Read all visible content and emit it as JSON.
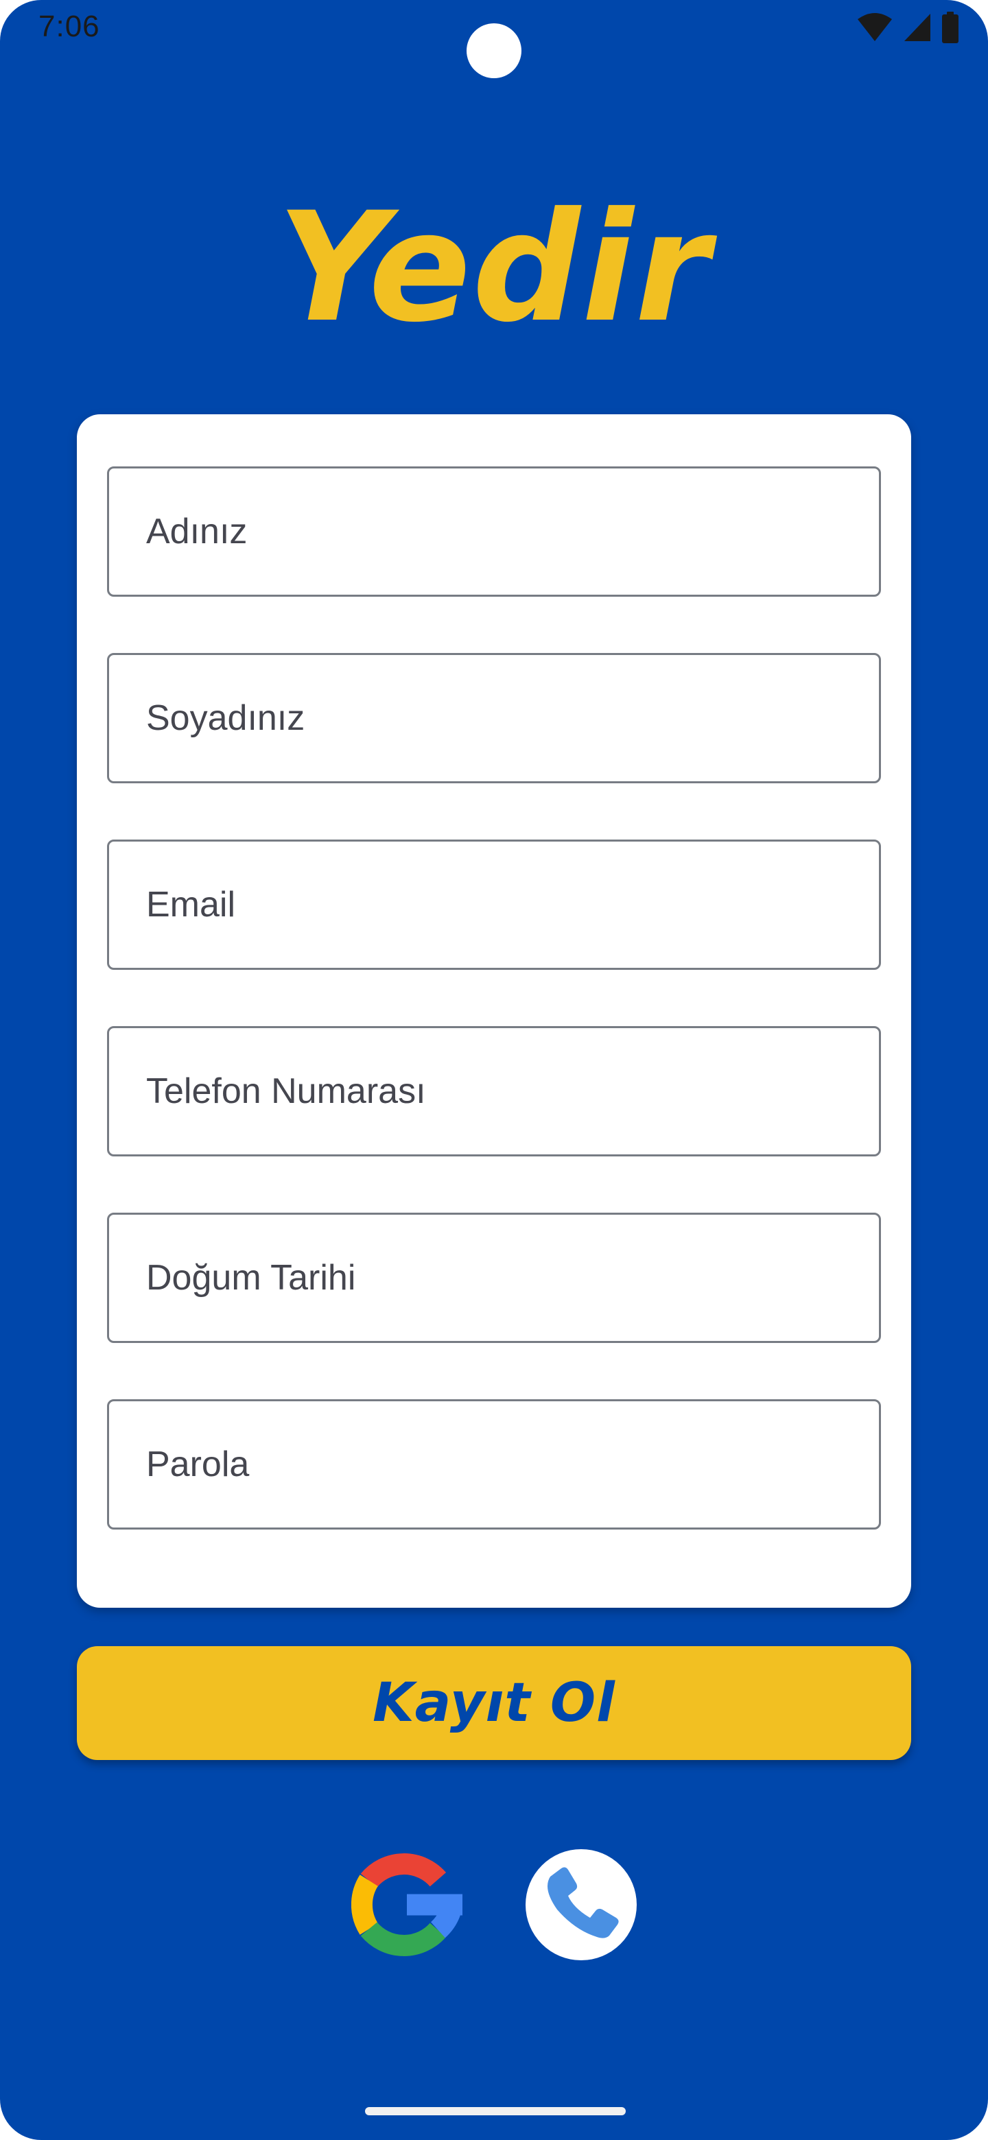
{
  "status_bar": {
    "time": "7:06",
    "icons": [
      "wifi-icon",
      "cell-signal-icon",
      "battery-icon"
    ]
  },
  "brand": {
    "name": "Yedir",
    "color": "#f2c022"
  },
  "form": {
    "fields": [
      {
        "placeholder": "Adınız"
      },
      {
        "placeholder": "Soyadınız"
      },
      {
        "placeholder": "Email"
      },
      {
        "placeholder": "Telefon Numarası"
      },
      {
        "placeholder": "Doğum Tarihi"
      },
      {
        "placeholder": "Parola"
      }
    ]
  },
  "submit": {
    "label": "Kayıt Ol",
    "background": "#f2c022",
    "text_color": "#0047ab"
  },
  "social_login": {
    "items": [
      "google-icon",
      "phone-icon"
    ]
  },
  "colors": {
    "background": "#0047ab",
    "card": "#ffffff",
    "accent": "#f2c022",
    "field_border": "#777c84",
    "phone_icon": "#4a90e2"
  }
}
